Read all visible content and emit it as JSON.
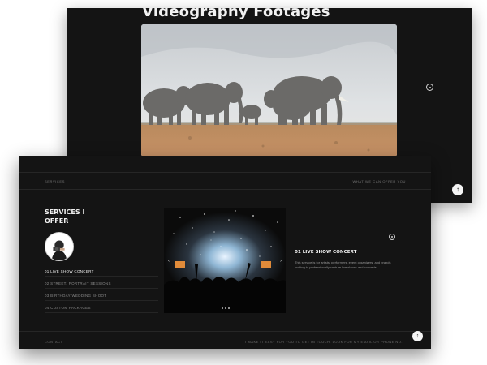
{
  "back_page": {
    "title": "Videography Footages",
    "hero_image": "elephant-herd-savanna",
    "nav_icon": "circle-dot-icon",
    "scroll_top_icon": "arrow-up-icon",
    "scroll_top_glyph": "↑"
  },
  "front_page": {
    "topbar": {
      "left": "SERVICES",
      "right": "WHAT WE CAN OFFER YOU"
    },
    "heading": "SERVICES I OFFER",
    "avatar": "photographer-avatar",
    "services": [
      {
        "label": "01 LIVE SHOW CONCERT",
        "active": true
      },
      {
        "label": "02 STREET/ PORTRAIT SESSIONS",
        "active": false
      },
      {
        "label": "03 BIRTHDAY/WEDDING SHOOT",
        "active": false
      },
      {
        "label": "04 CUSTOM PACKAGES",
        "active": false
      }
    ],
    "slider": {
      "image": "concert-crowd-stage",
      "prev_glyph": "‹",
      "next_glyph": "›",
      "dots": 3
    },
    "detail": {
      "title": "01 LIVE SHOW CONCERT",
      "description": "This service is for artists, performers, event organizers, and brands looking to professionally capture live shows and concerts."
    },
    "footer": {
      "left": "CONTACT",
      "right": "I MAKE IT EASY FOR YOU TO GET IN TOUCH. LOOK FOR MY EMAIL OR PHONE NO."
    },
    "scroll_top_glyph": "↑",
    "colors": {
      "background": "#141414",
      "text": "#f2f2f2",
      "muted": "#8a8a8a"
    }
  }
}
